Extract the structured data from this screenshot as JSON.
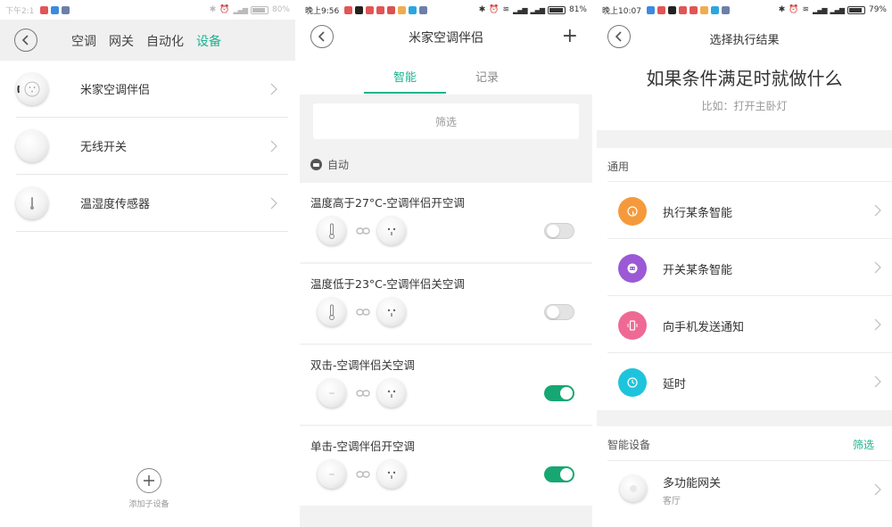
{
  "screen1": {
    "status": {
      "time": "下午2:1",
      "battery": "80%"
    },
    "tabs": [
      "空调",
      "网关",
      "自动化",
      "设备"
    ],
    "devices": [
      "米家空调伴侣",
      "无线开关",
      "温湿度传感器"
    ],
    "add_label": "添加子设备"
  },
  "screen2": {
    "status": {
      "time": "晚上9:56",
      "battery": "81%"
    },
    "title": "米家空调伴侣",
    "plus": "+",
    "tabs": {
      "smart": "智能",
      "log": "记录"
    },
    "filter_label": "筛选",
    "section_label": "自动",
    "rules": [
      {
        "title": "温度高于27°C-空调伴侣开空调",
        "enabled": false
      },
      {
        "title": "温度低于23°C-空调伴侣关空调",
        "enabled": false
      },
      {
        "title": "双击-空调伴侣关空调",
        "enabled": true
      },
      {
        "title": "单击-空调伴侣开空调",
        "enabled": true
      }
    ]
  },
  "screen3": {
    "status": {
      "time": "晚上10:07",
      "battery": "79%"
    },
    "title": "选择执行结果",
    "headline": "如果条件满足时就做什么",
    "hint": "比如：打开主卧灯",
    "general": {
      "label": "通用",
      "options": [
        {
          "label": "执行某条智能",
          "color": "#f59a3c",
          "icon": "pointer-icon"
        },
        {
          "label": "开关某条智能",
          "color": "#9b59d6",
          "icon": "robot-icon"
        },
        {
          "label": "向手机发送通知",
          "color": "#ee6a95",
          "icon": "phone-vibrate-icon"
        },
        {
          "label": "延时",
          "color": "#1ec4dc",
          "icon": "clock-icon"
        }
      ]
    },
    "devices": {
      "label": "智能设备",
      "filter": "筛选",
      "items": [
        {
          "name": "多功能网关",
          "room": "客厅"
        }
      ]
    }
  },
  "colors": {
    "accent": "#1bb38e",
    "toggle_on": "#17a773"
  }
}
